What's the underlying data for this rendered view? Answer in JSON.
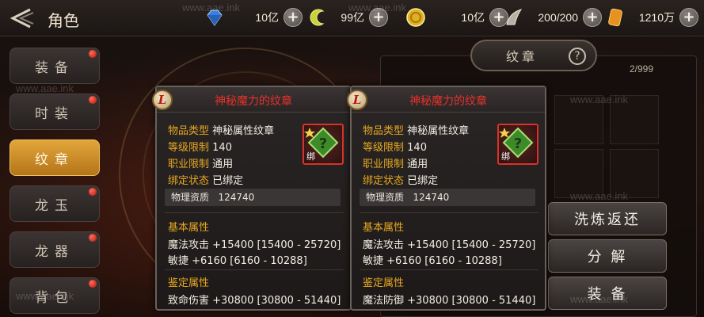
{
  "header": {
    "title": "角色"
  },
  "resources": [
    {
      "icon": "diamond-icon",
      "value": "10亿"
    },
    {
      "icon": "crescent-coin-icon",
      "value": "99亿"
    },
    {
      "icon": "gold-coin-icon",
      "value": "10亿"
    },
    {
      "icon": "fatigue-wing-icon",
      "value": "200/200"
    },
    {
      "icon": "crystal-bar-icon",
      "value": "1210万"
    }
  ],
  "menu": [
    {
      "label": "装备",
      "dot": true
    },
    {
      "label": "时装",
      "dot": true
    },
    {
      "label": "纹章",
      "dot": false,
      "active": true
    },
    {
      "label": "龙玉",
      "dot": true
    },
    {
      "label": "龙器",
      "dot": true
    },
    {
      "label": "背包",
      "dot": true
    }
  ],
  "panel": {
    "tab": "纹章",
    "count": "2/999"
  },
  "actions": {
    "refine": "洗炼返还",
    "decompose": "分 解",
    "equip": "装 备"
  },
  "cards": [
    {
      "badge": "L",
      "title": "神秘魔力的纹章",
      "bind_tag": "绑",
      "info": [
        {
          "label": "物品类型",
          "value": "神秘属性纹章"
        },
        {
          "label": "等级限制",
          "value": "140"
        },
        {
          "label": "职业限制",
          "value": "通用"
        },
        {
          "label": "绑定状态",
          "value": "已绑定"
        }
      ],
      "physical": "物理资质",
      "physical_value": "124740",
      "base_title": "基本属性",
      "base": [
        "魔法攻击 +15400 [15400 - 25720]",
        "敏捷 +6160 [6160 - 10288]"
      ],
      "appraise_title": "鉴定属性",
      "appraise": [
        "致命伤害 +30800 [30800 - 51440]"
      ]
    },
    {
      "badge": "L",
      "title": "神秘魔力的纹章",
      "bind_tag": "绑",
      "info": [
        {
          "label": "物品类型",
          "value": "神秘属性纹章"
        },
        {
          "label": "等级限制",
          "value": "140"
        },
        {
          "label": "职业限制",
          "value": "通用"
        },
        {
          "label": "绑定状态",
          "value": "已绑定"
        }
      ],
      "physical": "物理资质",
      "physical_value": "124740",
      "base_title": "基本属性",
      "base": [
        "魔法攻击 +15400 [15400 - 25720]",
        "敏捷 +6160 [6160 - 10288]"
      ],
      "appraise_title": "鉴定属性",
      "appraise": [
        "魔法防御 +30800 [30800 - 51440]"
      ]
    }
  ],
  "watermark": "www.aae.ink",
  "colors": {
    "label": "#e8a820",
    "title": "#e6322a",
    "active_tab": "#d9982e"
  }
}
